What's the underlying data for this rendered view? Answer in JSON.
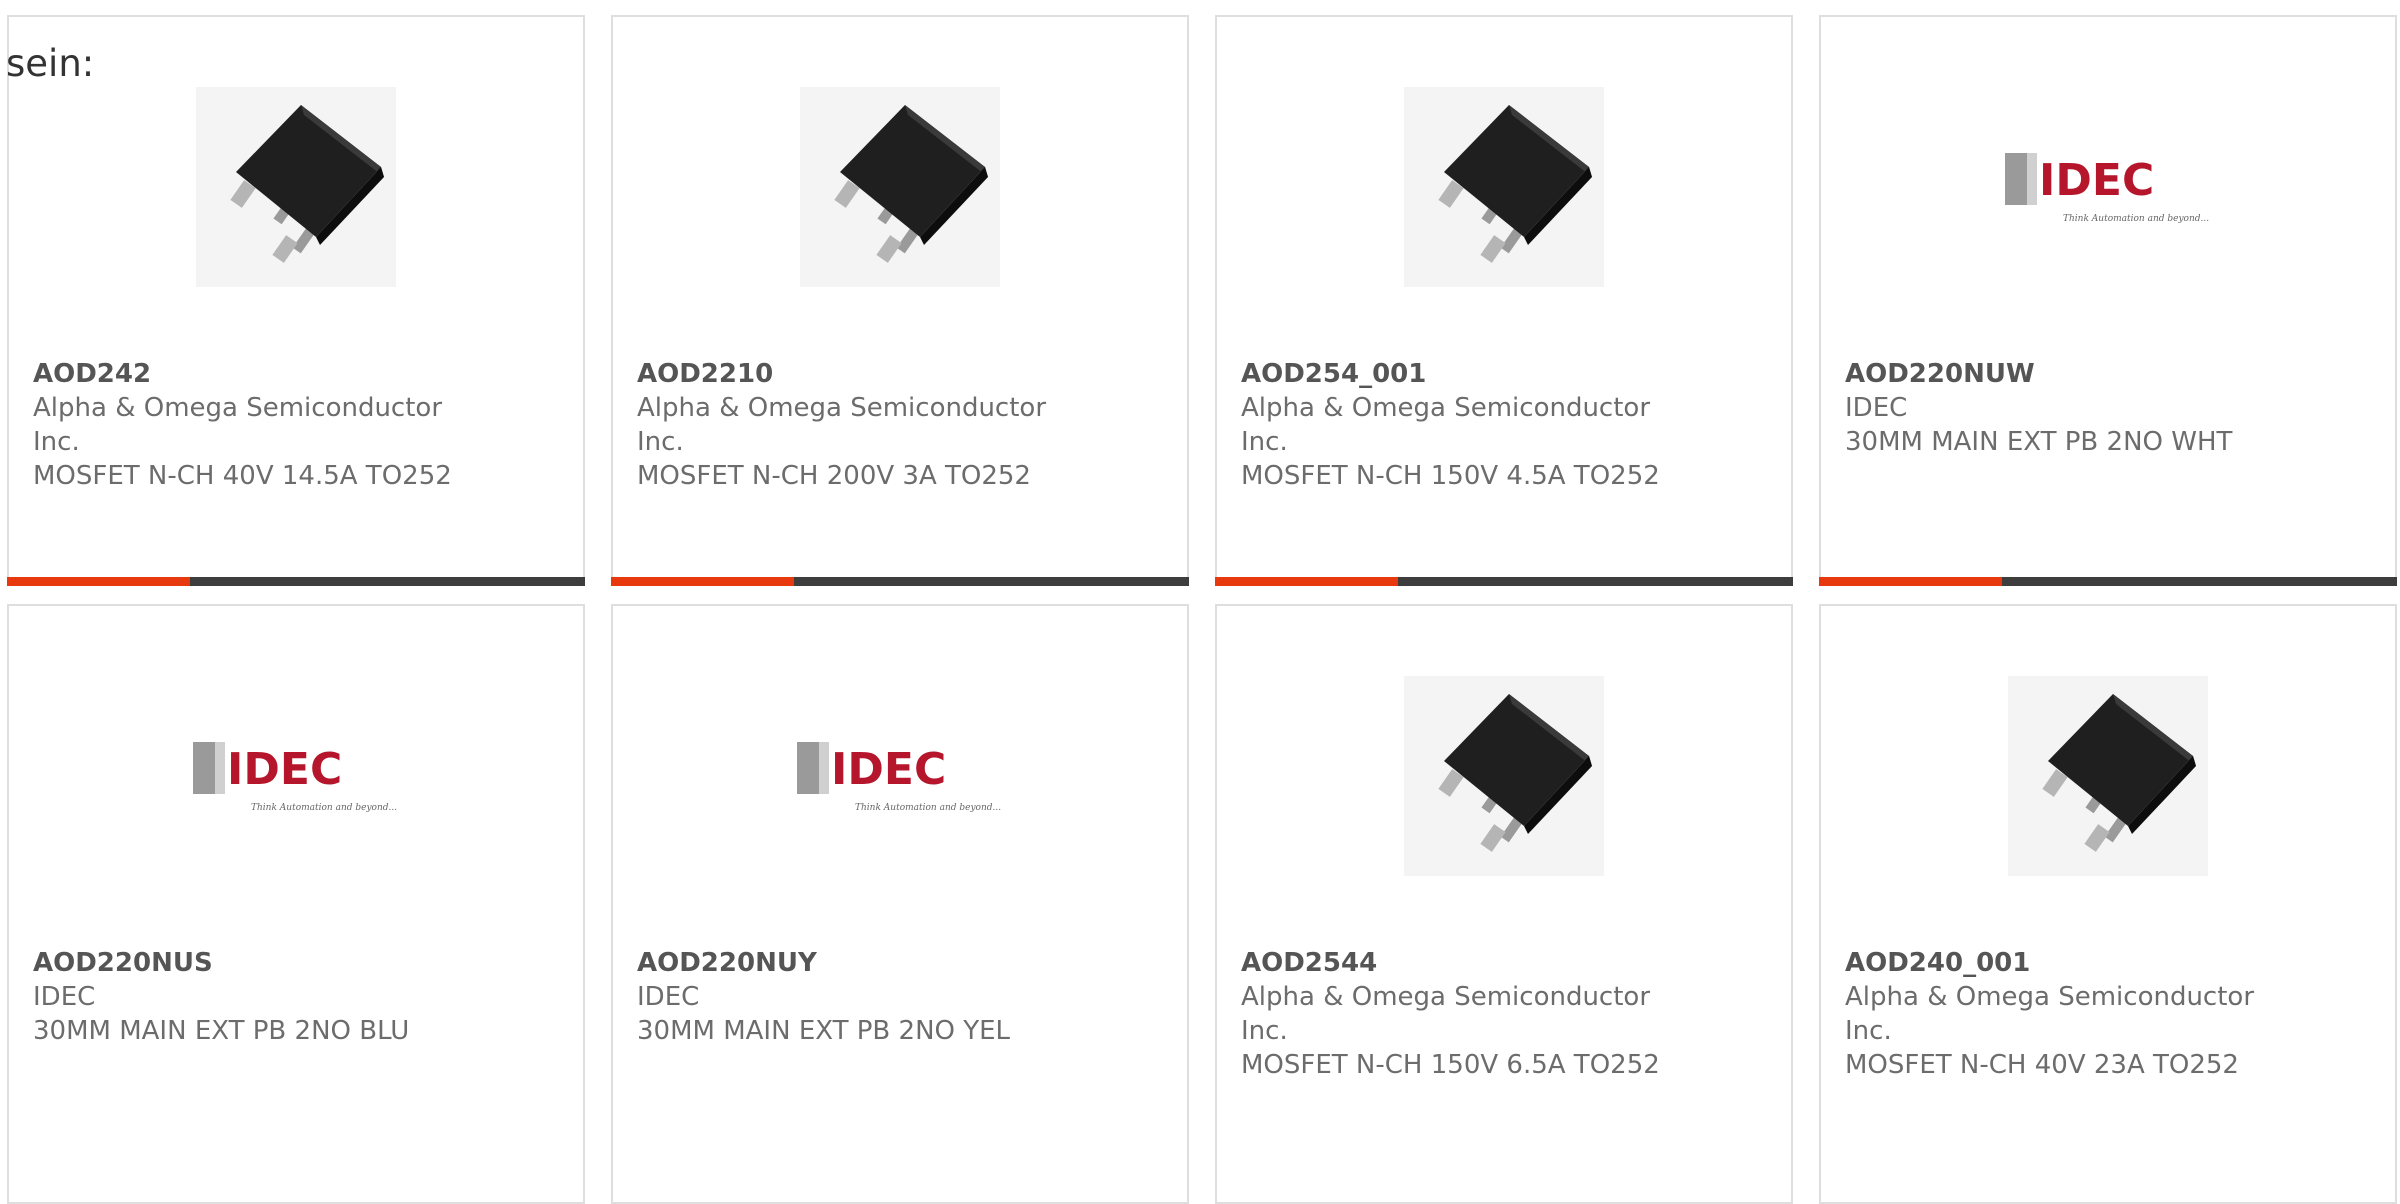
{
  "lead_text": "sein:",
  "colors": {
    "accent": "#e8380d",
    "bar": "#3d3d3d",
    "idec_red": "#b5162b"
  },
  "idec_logo": {
    "wordmark": "IDEC",
    "tagline": "Think Automation and beyond..."
  },
  "products": [
    {
      "part": "AOD242",
      "manufacturer": "Alpha & Omega Semiconductor Inc.",
      "description": "MOSFET N-CH 40V 14.5A TO252",
      "image": "to252-chip-icon"
    },
    {
      "part": "AOD2210",
      "manufacturer": "Alpha & Omega Semiconductor Inc.",
      "description": "MOSFET N-CH 200V 3A TO252",
      "image": "to252-chip-icon"
    },
    {
      "part": "AOD254_001",
      "manufacturer": "Alpha & Omega Semiconductor Inc.",
      "description": "MOSFET N-CH 150V 4.5A TO252",
      "image": "to252-chip-icon"
    },
    {
      "part": "AOD220NUW",
      "manufacturer": "IDEC",
      "description": "30MM MAIN EXT PB 2NO WHT",
      "image": "idec-logo"
    },
    {
      "part": "AOD220NUS",
      "manufacturer": "IDEC",
      "description": "30MM MAIN EXT PB 2NO BLU",
      "image": "idec-logo"
    },
    {
      "part": "AOD220NUY",
      "manufacturer": "IDEC",
      "description": "30MM MAIN EXT PB 2NO YEL",
      "image": "idec-logo"
    },
    {
      "part": "AOD2544",
      "manufacturer": "Alpha & Omega Semiconductor Inc.",
      "description": "MOSFET N-CH 150V 6.5A TO252",
      "image": "to252-chip-icon"
    },
    {
      "part": "AOD240_001",
      "manufacturer": "Alpha & Omega Semiconductor Inc.",
      "description": "MOSFET N-CH 40V 23A TO252",
      "image": "to252-chip-icon"
    }
  ]
}
